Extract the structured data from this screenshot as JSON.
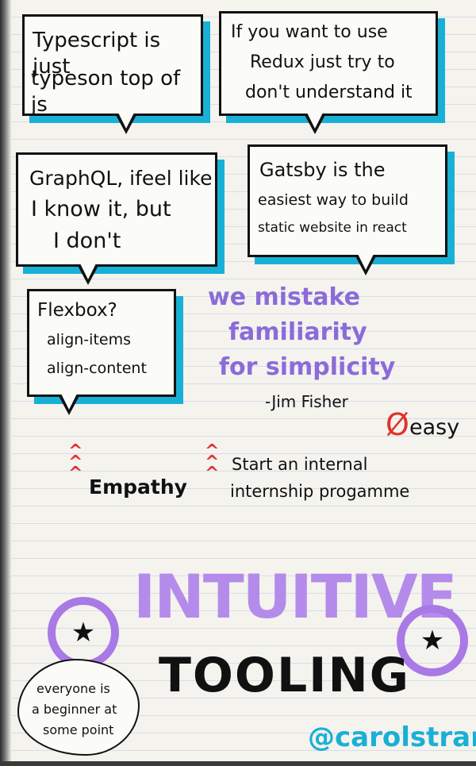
{
  "bubbles": {
    "typescript": [
      "Typescript is just",
      "typeson top of js"
    ],
    "redux": [
      "If you want to use",
      "Redux just try to",
      "don't understand it"
    ],
    "graphql": [
      "GraphQL, ifeel like",
      "I know it, but",
      "I don't"
    ],
    "gatsby": [
      "Gatsby is the",
      "easiest way to build",
      "static website in react"
    ],
    "flexbox": [
      "Flexbox?",
      "align-items",
      "align-content"
    ]
  },
  "quote": {
    "lines": [
      "we mistake",
      "familiarity",
      "for simplicity"
    ],
    "author": "-Jim Fisher"
  },
  "easy_note": "easy",
  "no_symbol": "Ø",
  "bullets": {
    "empathy": "Empathy",
    "internship": [
      "Start an internal",
      "internship progamme"
    ]
  },
  "headline": {
    "top": "INTUITIVE",
    "bottom": "TOOLING"
  },
  "cloud_note": [
    "everyone is",
    "a beginner at",
    "some point"
  ],
  "signature": "@carolstran",
  "colors": {
    "accent_blue": "#19b0d6",
    "accent_purple": "#a979e6",
    "accent_red": "#e0332a"
  },
  "icons": [
    "star-icon",
    "chevron-up-icon"
  ]
}
